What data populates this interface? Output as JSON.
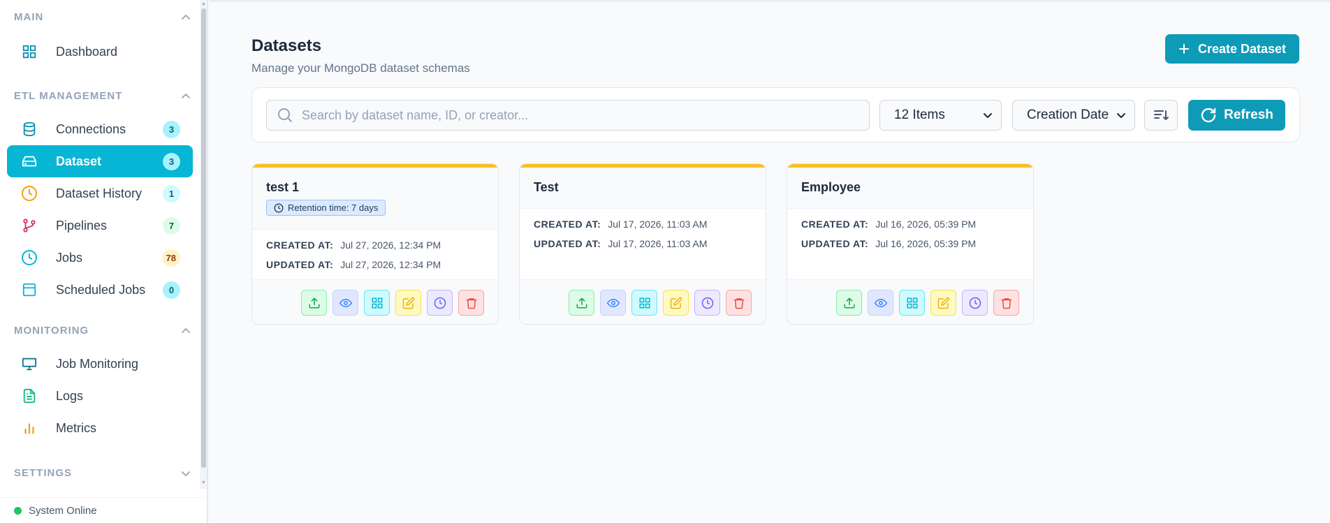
{
  "sidebar": {
    "sections": [
      {
        "title": "MAIN",
        "chevron": "chevron-up-icon"
      },
      {
        "title": "ETL MANAGEMENT",
        "chevron": "chevron-up-icon"
      },
      {
        "title": "MONITORING",
        "chevron": "chevron-up-icon"
      },
      {
        "title": "SETTINGS",
        "chevron": "chevron-down-icon"
      }
    ],
    "items": [
      {
        "label": "Dashboard",
        "icon": "dashboard-grid-icon",
        "color": "#0891b2"
      },
      {
        "label": "Connections",
        "icon": "database-icon",
        "badge": "3",
        "color": "#0891b2",
        "badge_bg": "#a5f3fc"
      },
      {
        "label": "Dataset",
        "icon": "hard-drive-icon",
        "badge": "3",
        "active": true,
        "color": "#ffffff",
        "badge_bg": "#a5f3fc"
      },
      {
        "label": "Dataset History",
        "icon": "clock-icon",
        "badge": "1",
        "color": "#f59e0b",
        "badge_bg": "#cffafe"
      },
      {
        "label": "Pipelines",
        "icon": "git-branch-icon",
        "badge": "7",
        "color": "#db2777",
        "badge_bg": "#dcfce7"
      },
      {
        "label": "Jobs",
        "icon": "clock-icon",
        "badge": "78",
        "color": "#06b6d4",
        "badge_bg": "#fef3c7"
      },
      {
        "label": "Scheduled Jobs",
        "icon": "calendar-icon",
        "badge": "0",
        "color": "#06b6d4",
        "badge_bg": "#a5f3fc"
      },
      {
        "label": "Job Monitoring",
        "icon": "monitor-icon",
        "color": "#0e7490"
      },
      {
        "label": "Logs",
        "icon": "file-text-icon",
        "color": "#10b981"
      },
      {
        "label": "Metrics",
        "icon": "bar-chart-icon",
        "color": "#f59e0b"
      }
    ],
    "status": "System Online"
  },
  "header": {
    "title": "Datasets",
    "subtitle": "Manage your MongoDB dataset schemas",
    "create_label": "Create Dataset"
  },
  "toolbar": {
    "search_placeholder": "Search by dataset name, ID, or creator...",
    "items_select": "12 Items",
    "sort_select": "Creation Date",
    "refresh_label": "Refresh"
  },
  "labels": {
    "created_at": "CREATED AT:",
    "updated_at": "UPDATED AT:"
  },
  "datasets": [
    {
      "name": "test 1",
      "retention": "Retention time: 7 days",
      "created": "Jul 27, 2026, 12:34 PM",
      "updated": "Jul 27, 2026, 12:34 PM"
    },
    {
      "name": "Test",
      "created": "Jul 17, 2026, 11:03 AM",
      "updated": "Jul 17, 2026, 11:03 AM"
    },
    {
      "name": "Employee",
      "created": "Jul 16, 2026, 05:39 PM",
      "updated": "Jul 16, 2026, 05:39 PM"
    }
  ],
  "colors": {
    "accent": "#06b6d4",
    "primary_button": "#0e9bb7",
    "card_top": "#fbbf24"
  }
}
